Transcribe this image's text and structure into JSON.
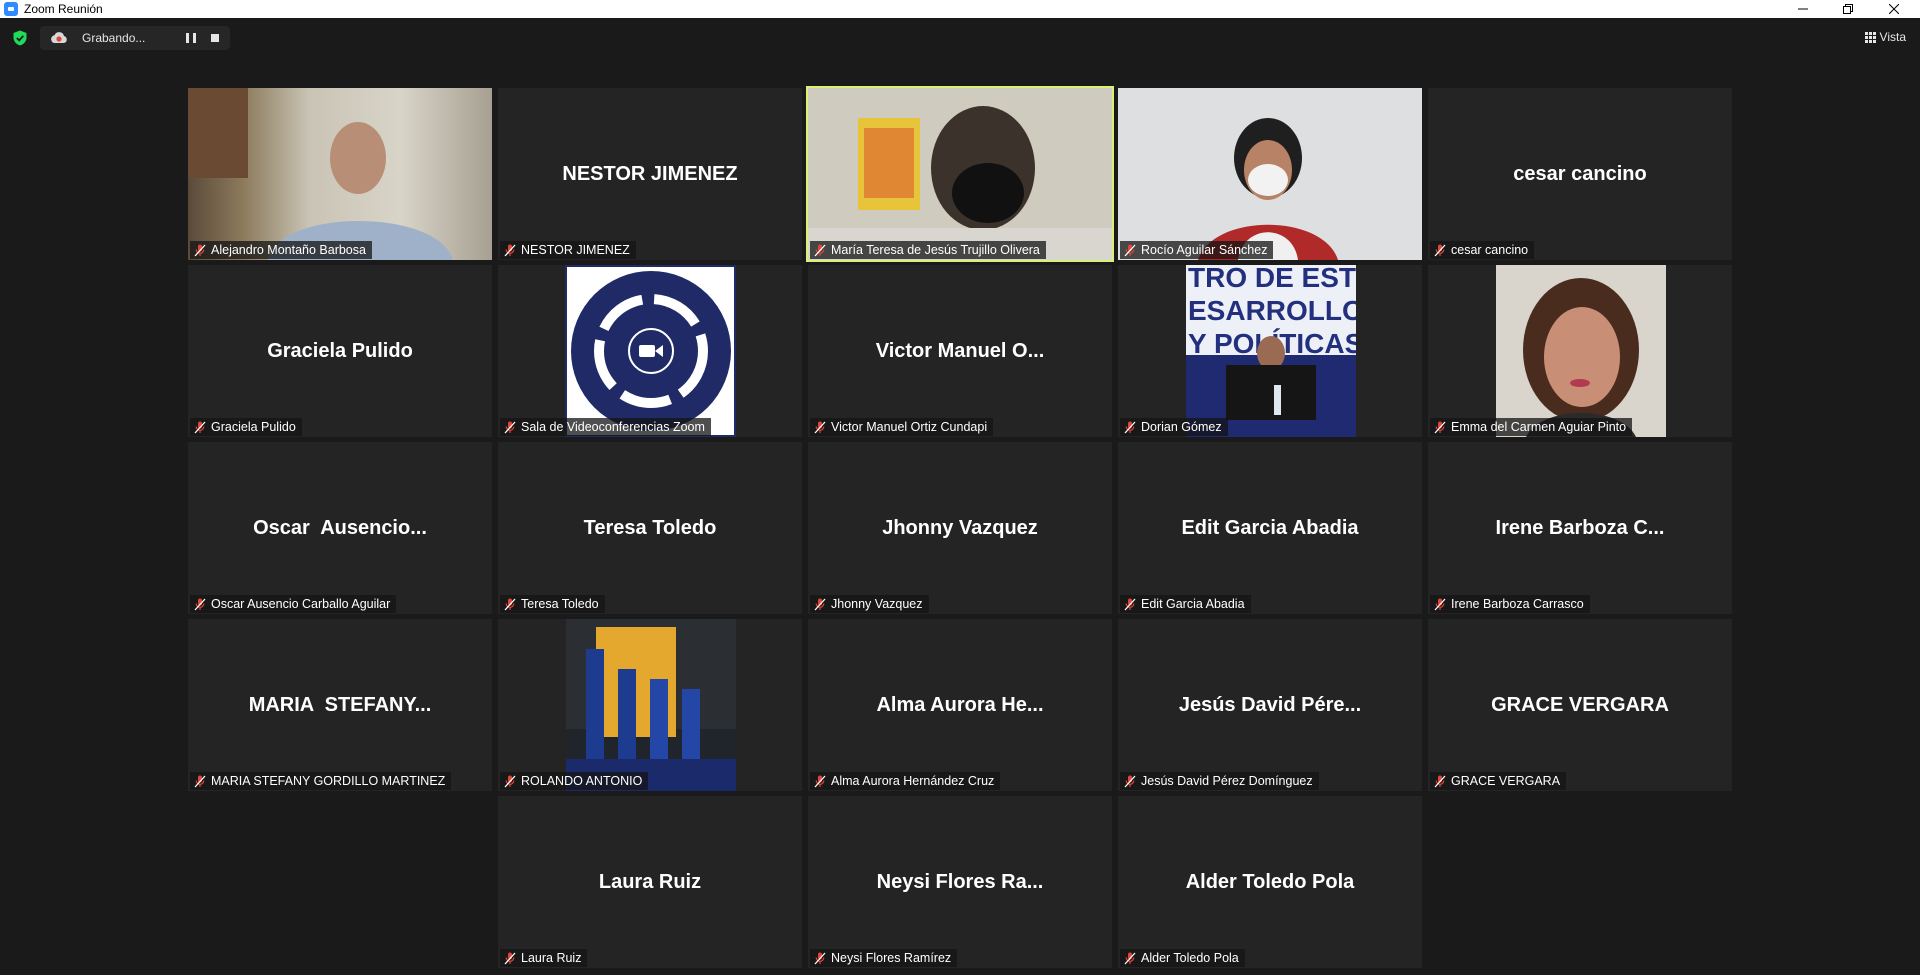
{
  "window": {
    "title": "Zoom Reunión",
    "controls": [
      "minimize",
      "restore",
      "close"
    ]
  },
  "toolbar": {
    "recording_label": "Grabando...",
    "view_label": "Vista"
  },
  "colors": {
    "background": "#1a1a1a",
    "tile": "#242424",
    "active_speaker_border": "#d9f07a",
    "muted_icon": "#e0453a",
    "security_shield": "#23d959"
  },
  "participants": [
    {
      "display": "",
      "label": "Alejandro Montaño Barbosa",
      "video": "photo"
    },
    {
      "display": "NESTOR JIMENEZ",
      "label": "NESTOR JIMENEZ",
      "video": "none"
    },
    {
      "display": "",
      "label": "María Teresa de Jesús Trujillo Olivera",
      "video": "photo",
      "active": true
    },
    {
      "display": "",
      "label": "Rocío Aguilar Sánchez",
      "video": "photo"
    },
    {
      "display": "cesar cancino",
      "label": "cesar cancino",
      "video": "none"
    },
    {
      "display": "Graciela Pulido",
      "label": "Graciela Pulido",
      "video": "none"
    },
    {
      "display": "",
      "label": "Sala de Videoconferencias Zoom",
      "video": "logo"
    },
    {
      "display": "Victor Manuel O...",
      "label": "Victor Manuel Ortiz Cundapi",
      "video": "none"
    },
    {
      "display": "",
      "label": "Dorian Gómez",
      "video": "photo"
    },
    {
      "display": "",
      "label": "Emma del Carmen Aguiar Pinto",
      "video": "photo"
    },
    {
      "display": "Oscar  Ausencio...",
      "label": "Oscar Ausencio Carballo Aguilar",
      "video": "none"
    },
    {
      "display": "Teresa Toledo",
      "label": "Teresa Toledo",
      "video": "none"
    },
    {
      "display": "Jhonny Vazquez",
      "label": "Jhonny Vazquez",
      "video": "none"
    },
    {
      "display": "Edit Garcia Abadia",
      "label": "Edit Garcia Abadia",
      "video": "none"
    },
    {
      "display": "Irene Barboza C...",
      "label": "Irene Barboza Carrasco",
      "video": "none"
    },
    {
      "display": "MARIA  STEFANY...",
      "label": "MARIA STEFANY GORDILLO MARTINEZ",
      "video": "none"
    },
    {
      "display": "",
      "label": "ROLANDO ANTONIO",
      "video": "photo"
    },
    {
      "display": "Alma Aurora He...",
      "label": "Alma Aurora Hernández Cruz",
      "video": "none"
    },
    {
      "display": "Jesús David Pére...",
      "label": "Jesús David Pérez Domínguez",
      "video": "none"
    },
    {
      "display": "GRACE VERGARA",
      "label": "GRACE VERGARA",
      "video": "none"
    },
    {
      "display": "Laura Ruiz",
      "label": "Laura Ruiz",
      "video": "none"
    },
    {
      "display": "Neysi Flores Ra...",
      "label": "Neysi Flores Ramírez",
      "video": "none"
    },
    {
      "display": "Alder Toledo Pola",
      "label": "Alder Toledo Pola",
      "video": "none"
    }
  ]
}
